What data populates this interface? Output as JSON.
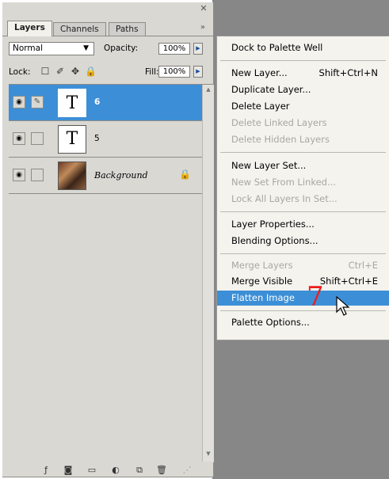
{
  "tabs": [
    {
      "label": "Layers",
      "active": true
    },
    {
      "label": "Channels",
      "active": false
    },
    {
      "label": "Paths",
      "active": false
    }
  ],
  "blend_mode": "Normal",
  "opacity_label": "Opacity:",
  "opacity_value": "100%",
  "lock_label": "Lock:",
  "fill_label": "Fill:",
  "fill_value": "100%",
  "layers": [
    {
      "name": "6",
      "type": "text",
      "selected": true
    },
    {
      "name": "5",
      "type": "text",
      "selected": false
    },
    {
      "name": "Background",
      "type": "image",
      "selected": false
    }
  ],
  "thumb_glyph": "T",
  "menu": {
    "items": [
      {
        "label": "Dock to Palette Well",
        "shortcut": "",
        "disabled": false
      },
      {
        "label": "New Layer...",
        "shortcut": "Shift+Ctrl+N",
        "disabled": false
      },
      {
        "label": "Duplicate Layer...",
        "shortcut": "",
        "disabled": false
      },
      {
        "label": "Delete Layer",
        "shortcut": "",
        "disabled": false
      },
      {
        "label": "Delete Linked Layers",
        "shortcut": "",
        "disabled": true
      },
      {
        "label": "Delete Hidden Layers",
        "shortcut": "",
        "disabled": true
      },
      {
        "label": "New Layer Set...",
        "shortcut": "",
        "disabled": false
      },
      {
        "label": "New Set From Linked...",
        "shortcut": "",
        "disabled": true
      },
      {
        "label": "Lock All Layers In Set...",
        "shortcut": "",
        "disabled": true
      },
      {
        "label": "Layer Properties...",
        "shortcut": "",
        "disabled": false
      },
      {
        "label": "Blending Options...",
        "shortcut": "",
        "disabled": false
      },
      {
        "label": "Merge Layers",
        "shortcut": "Ctrl+E",
        "disabled": true
      },
      {
        "label": "Merge Visible",
        "shortcut": "Shift+Ctrl+E",
        "disabled": false
      },
      {
        "label": "Flatten Image",
        "shortcut": "",
        "disabled": false,
        "highlighted": true
      },
      {
        "label": "Palette Options...",
        "shortcut": "",
        "disabled": false
      }
    ]
  },
  "step_marker": "7",
  "colors": {
    "selection": "#3c8fd6",
    "panel": "#d9d8d3",
    "marker": "#ef1b1b"
  }
}
